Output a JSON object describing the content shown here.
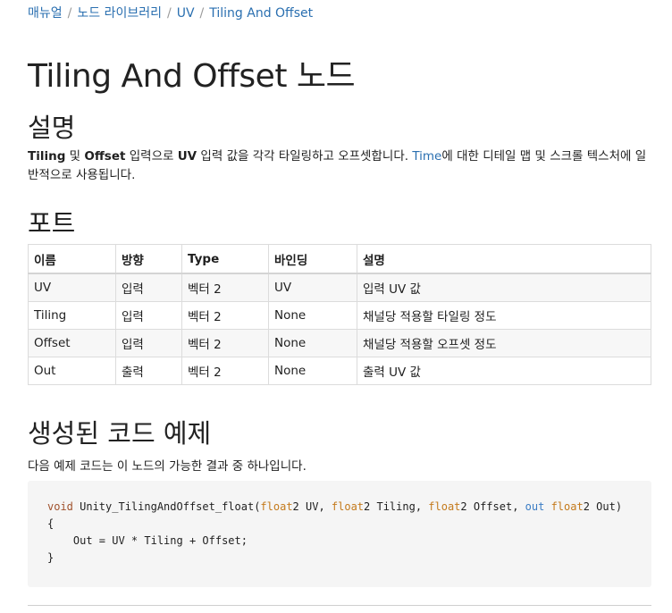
{
  "breadcrumb": [
    "매뉴얼",
    "노드 라이브러리",
    "UV",
    "Tiling And Offset"
  ],
  "page_title": "Tiling And Offset 노드",
  "sections": {
    "description_heading": "설명",
    "ports_heading": "포트",
    "code_heading": "생성된 코드 예제"
  },
  "description": {
    "b1": "Tiling",
    "t1": " 및 ",
    "b2": "Offset",
    "t2": " 입력으로 ",
    "b3": "UV",
    "t3": " 입력 값을 각각 타일링하고 오프셋합니다. ",
    "link": "Time",
    "t4": "에 대한 디테일 맵 및 스크롤 텍스처에 일반적으로 사용됩니다."
  },
  "ports_table": {
    "headers": [
      "이름",
      "방향",
      "Type",
      "바인딩",
      "설명"
    ],
    "rows": [
      [
        "UV",
        "입력",
        "벡터 2",
        "UV",
        "입력 UV 값"
      ],
      [
        "Tiling",
        "입력",
        "벡터 2",
        "None",
        "채널당 적용할 타일링 정도"
      ],
      [
        "Offset",
        "입력",
        "벡터 2",
        "None",
        "채널당 적용할 오프셋 정도"
      ],
      [
        "Out",
        "출력",
        "벡터 2",
        "None",
        "출력 UV 값"
      ]
    ]
  },
  "code_intro": "다음 예제 코드는 이 노드의 가능한 결과 중 하나입니다.",
  "code": {
    "void": "void",
    "fn": " Unity_TilingAndOffset_float(",
    "float": "float",
    "p1": "2 UV, ",
    "p2": "2 Tiling, ",
    "p3": "2 Offset, ",
    "out": "out",
    "p4": "2 Out)",
    "open": "{",
    "body": "    Out = UV * Tiling + Offset;",
    "close": "}"
  }
}
